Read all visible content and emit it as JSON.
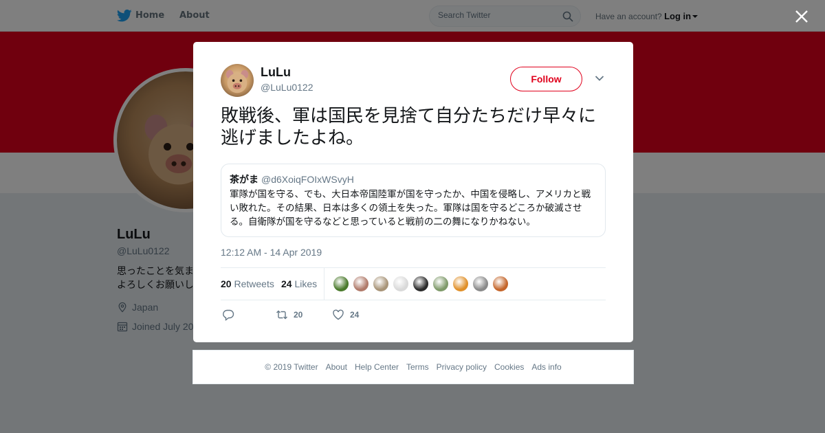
{
  "topbar": {
    "home_label": "Home",
    "about_label": "About",
    "search_placeholder": "Search Twitter",
    "account_prompt": "Have an account?",
    "login_label": "Log in"
  },
  "profile": {
    "name": "LuLu",
    "handle": "@LuLu0122",
    "bio_line1": "思ったことを気ま",
    "bio_line2": "よろしくお願いし",
    "location": "Japan",
    "joined": "Joined July 20"
  },
  "tweet": {
    "author_name": "LuLu",
    "author_handle": "@LuLu0122",
    "follow_label": "Follow",
    "text": "敗戦後、軍は国民を見捨て自分たちだけ早々に逃げましたよね。",
    "quote": {
      "name": "茶がま",
      "handle": "@d6XoiqFOIxWSvyH",
      "text": "軍隊が国を守る、でも、大日本帝国陸軍が国を守ったか、中国を侵略し、アメリカと戦い敗れた。その結果、日本は多くの領土を失った。軍隊は国を守るどころか破滅させる。自衛隊が国を守るなどと思っていると戦前の二の舞になりかねない。"
    },
    "timestamp": "12:12 AM - 14 Apr 2019",
    "retweets_count": "20",
    "retweets_label": "Retweets",
    "likes_count": "24",
    "likes_label": "Likes",
    "action_retweet_count": "20",
    "action_like_count": "24",
    "likers": [
      {
        "color": "#4a7a2c"
      },
      {
        "color": "#b07a6a"
      },
      {
        "color": "#a89478"
      },
      {
        "color": "#d9d9d9"
      },
      {
        "color": "#2b2b2b"
      },
      {
        "color": "#7f9a6a"
      },
      {
        "color": "#e0902a"
      },
      {
        "color": "#8a8a8a"
      },
      {
        "color": "#c4652a"
      }
    ]
  },
  "footer": {
    "copyright": "© 2019 Twitter",
    "about": "About",
    "help": "Help Center",
    "terms": "Terms",
    "privacy": "Privacy policy",
    "cookies": "Cookies",
    "ads": "Ads info"
  },
  "colors": {
    "accent": "#e0001c",
    "brand": "#1da1f2"
  }
}
